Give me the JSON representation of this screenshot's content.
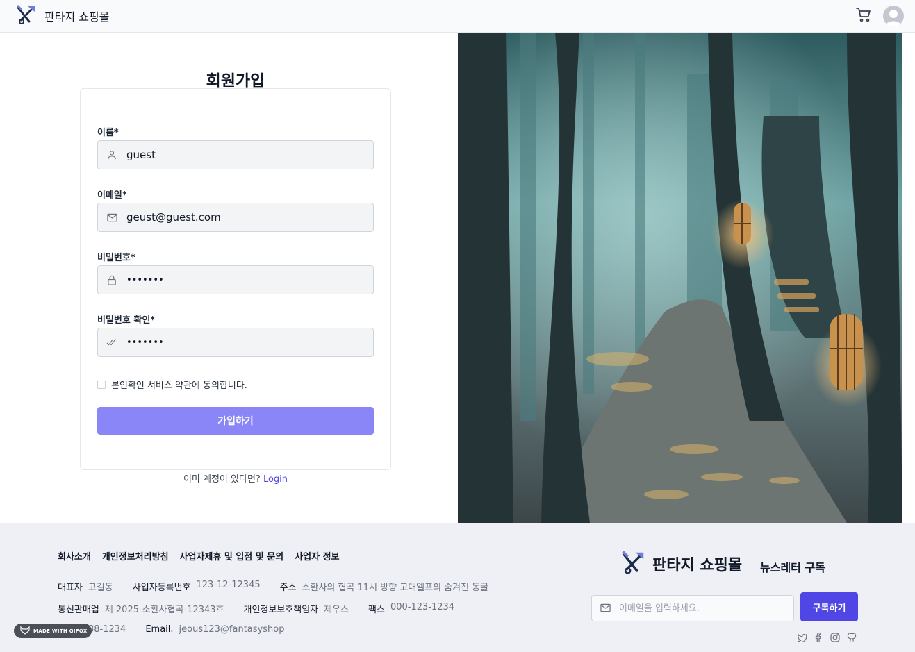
{
  "header": {
    "brand_name": "판타지 쇼핑몰",
    "icons": [
      "logo-sword-icon",
      "cart-icon",
      "avatar"
    ]
  },
  "signup": {
    "title": "회원가입",
    "name_label": "이름*",
    "name_value": "guest",
    "email_label": "이메일*",
    "email_value": "geust@guest.com",
    "password_label": "비밀번호*",
    "password_value": "•••••••",
    "confirm_label": "비밀번호 확인*",
    "confirm_value": "•••••••",
    "agree_label": "본인확인 서비스 약관에 동의합니다.",
    "submit_label": "가입하기",
    "login_prompt": "이미 계정이 있다면?",
    "login_link": "Login"
  },
  "footer": {
    "links": [
      "회사소개",
      "개인정보처리방침",
      "사업자제휴 및 입점 및 문의",
      "사업자 정보"
    ],
    "row1": [
      {
        "k": "대표자",
        "v": "고길동"
      },
      {
        "k": "사업자등록번호",
        "v": "123-12-12345"
      },
      {
        "k": "주소",
        "v": "소환사의 협곡 11시 방향 고대엘프의 숨겨진 동굴"
      }
    ],
    "row2": [
      {
        "k": "통신판매업",
        "v": "제 2025-소환사협곡-12343호"
      },
      {
        "k": "개인정보보호책임자",
        "v": "제우스"
      },
      {
        "k": "팩스",
        "v": "000-123-1234"
      }
    ],
    "row3": [
      {
        "k": "",
        "v": "88-1234"
      },
      {
        "k": "Email.",
        "v": "jeous123@fantasyshop"
      }
    ],
    "brand_name": "판타지 쇼핑몰",
    "newsletter_title": "뉴스레터 구독",
    "subscribe_placeholder": "이메일을 입력하세요.",
    "subscribe_button": "구독하기",
    "social_icons": [
      "twitter-icon",
      "facebook-icon",
      "instagram-icon",
      "github-icon"
    ]
  },
  "badge_text": "MADE WITH GIFOX",
  "colors": {
    "accent": "#4f46e5",
    "submit_disabled": "#8b86f7",
    "footer_bg": "#eef0f5"
  }
}
